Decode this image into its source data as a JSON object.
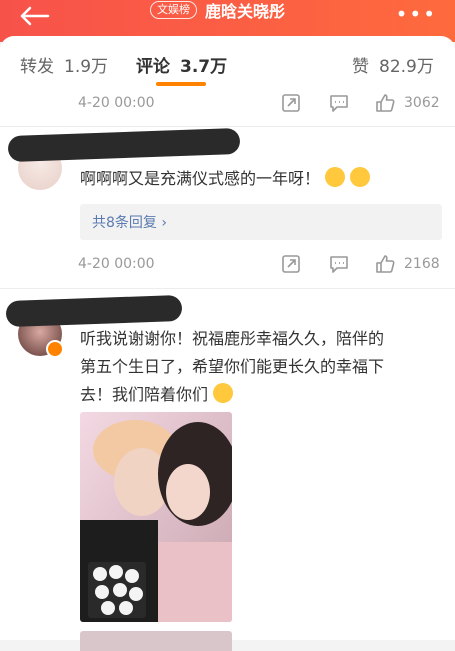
{
  "header": {
    "tag": "文娱榜",
    "title": "鹿晗关晓彤",
    "more": "•••"
  },
  "tabs": {
    "repost_label": "转发",
    "repost_count": "1.9万",
    "comment_label": "评论",
    "comment_count": "3.7万",
    "like_label": "赞",
    "like_count": "82.9万"
  },
  "comments": [
    {
      "date": "4-20 00:00",
      "likes": "3062",
      "text": "啊啊啊又是充满仪式感的一年呀！",
      "replies": "共8条回复  ›"
    },
    {
      "date": "4-20 00:00",
      "likes": "2168",
      "text_line1": "听我说谢谢你！祝福鹿彤幸福久久，陪伴的",
      "text_line2": "第五个生日了，希望你们能更长久的幸福下",
      "text_line3": "去！我们陪着你们"
    }
  ],
  "colors": {
    "header_start": "#f7524a",
    "header_end": "#ff6a3d",
    "accent": "#ff8200",
    "link": "#5b7bb0"
  },
  "icons": [
    "back-arrow-icon",
    "more-icon",
    "share-icon",
    "comment-icon",
    "like-icon",
    "chevron-right-icon",
    "emoji-icon",
    "verified-badge-icon"
  ]
}
